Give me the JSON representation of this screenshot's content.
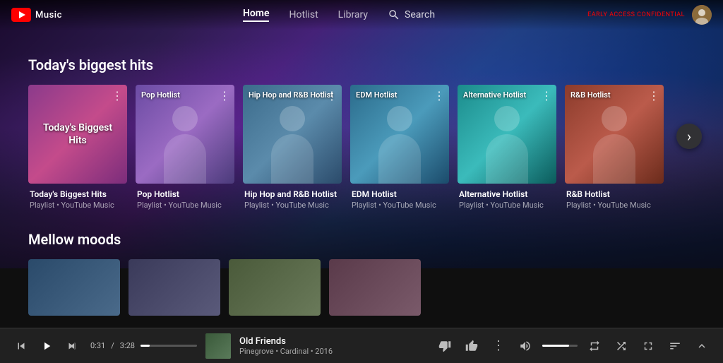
{
  "app": {
    "name": "Music",
    "logo_alt": "YouTube Music logo"
  },
  "header": {
    "early_access": "EARLY ACCESS CONFIDENTIAL",
    "nav": {
      "home": "Home",
      "hotlist": "Hotlist",
      "library": "Library",
      "search": "Search"
    }
  },
  "sections": [
    {
      "id": "biggest-hits",
      "title": "Today's biggest hits",
      "cards": [
        {
          "title": "Today's Biggest Hits",
          "sub": "Playlist • YouTube Music",
          "overlay_label": "Today's Biggest Hits",
          "overlay_large": true
        },
        {
          "title": "Pop Hotlist",
          "sub": "Playlist • YouTube Music",
          "overlay_label": "Pop Hotlist",
          "overlay_large": false
        },
        {
          "title": "Hip Hop and R&B Hotlist",
          "sub": "Playlist • YouTube Music",
          "overlay_label": "Hip Hop and R&B Hotlist",
          "overlay_large": false
        },
        {
          "title": "EDM Hotlist",
          "sub": "Playlist • YouTube Music",
          "overlay_label": "EDM Hotlist",
          "overlay_large": false
        },
        {
          "title": "Alternative Hotlist",
          "sub": "Playlist • YouTube Music",
          "overlay_label": "Alternative Hotlist",
          "overlay_large": false
        },
        {
          "title": "R&B Hotlist",
          "sub": "Playlist • YouTube Music",
          "overlay_label": "R&B Hotlist",
          "overlay_large": false
        }
      ]
    },
    {
      "id": "mellow-moods",
      "title": "Mellow moods",
      "cards": [
        {
          "title": "",
          "sub": ""
        },
        {
          "title": "",
          "sub": ""
        },
        {
          "title": "",
          "sub": ""
        },
        {
          "title": "",
          "sub": ""
        }
      ]
    }
  ],
  "player": {
    "track_title": "Old Friends",
    "track_sub": "Pinegrove • Cardinal • 2016",
    "current_time": "0:31",
    "total_time": "3:28",
    "progress_pct": 16
  }
}
